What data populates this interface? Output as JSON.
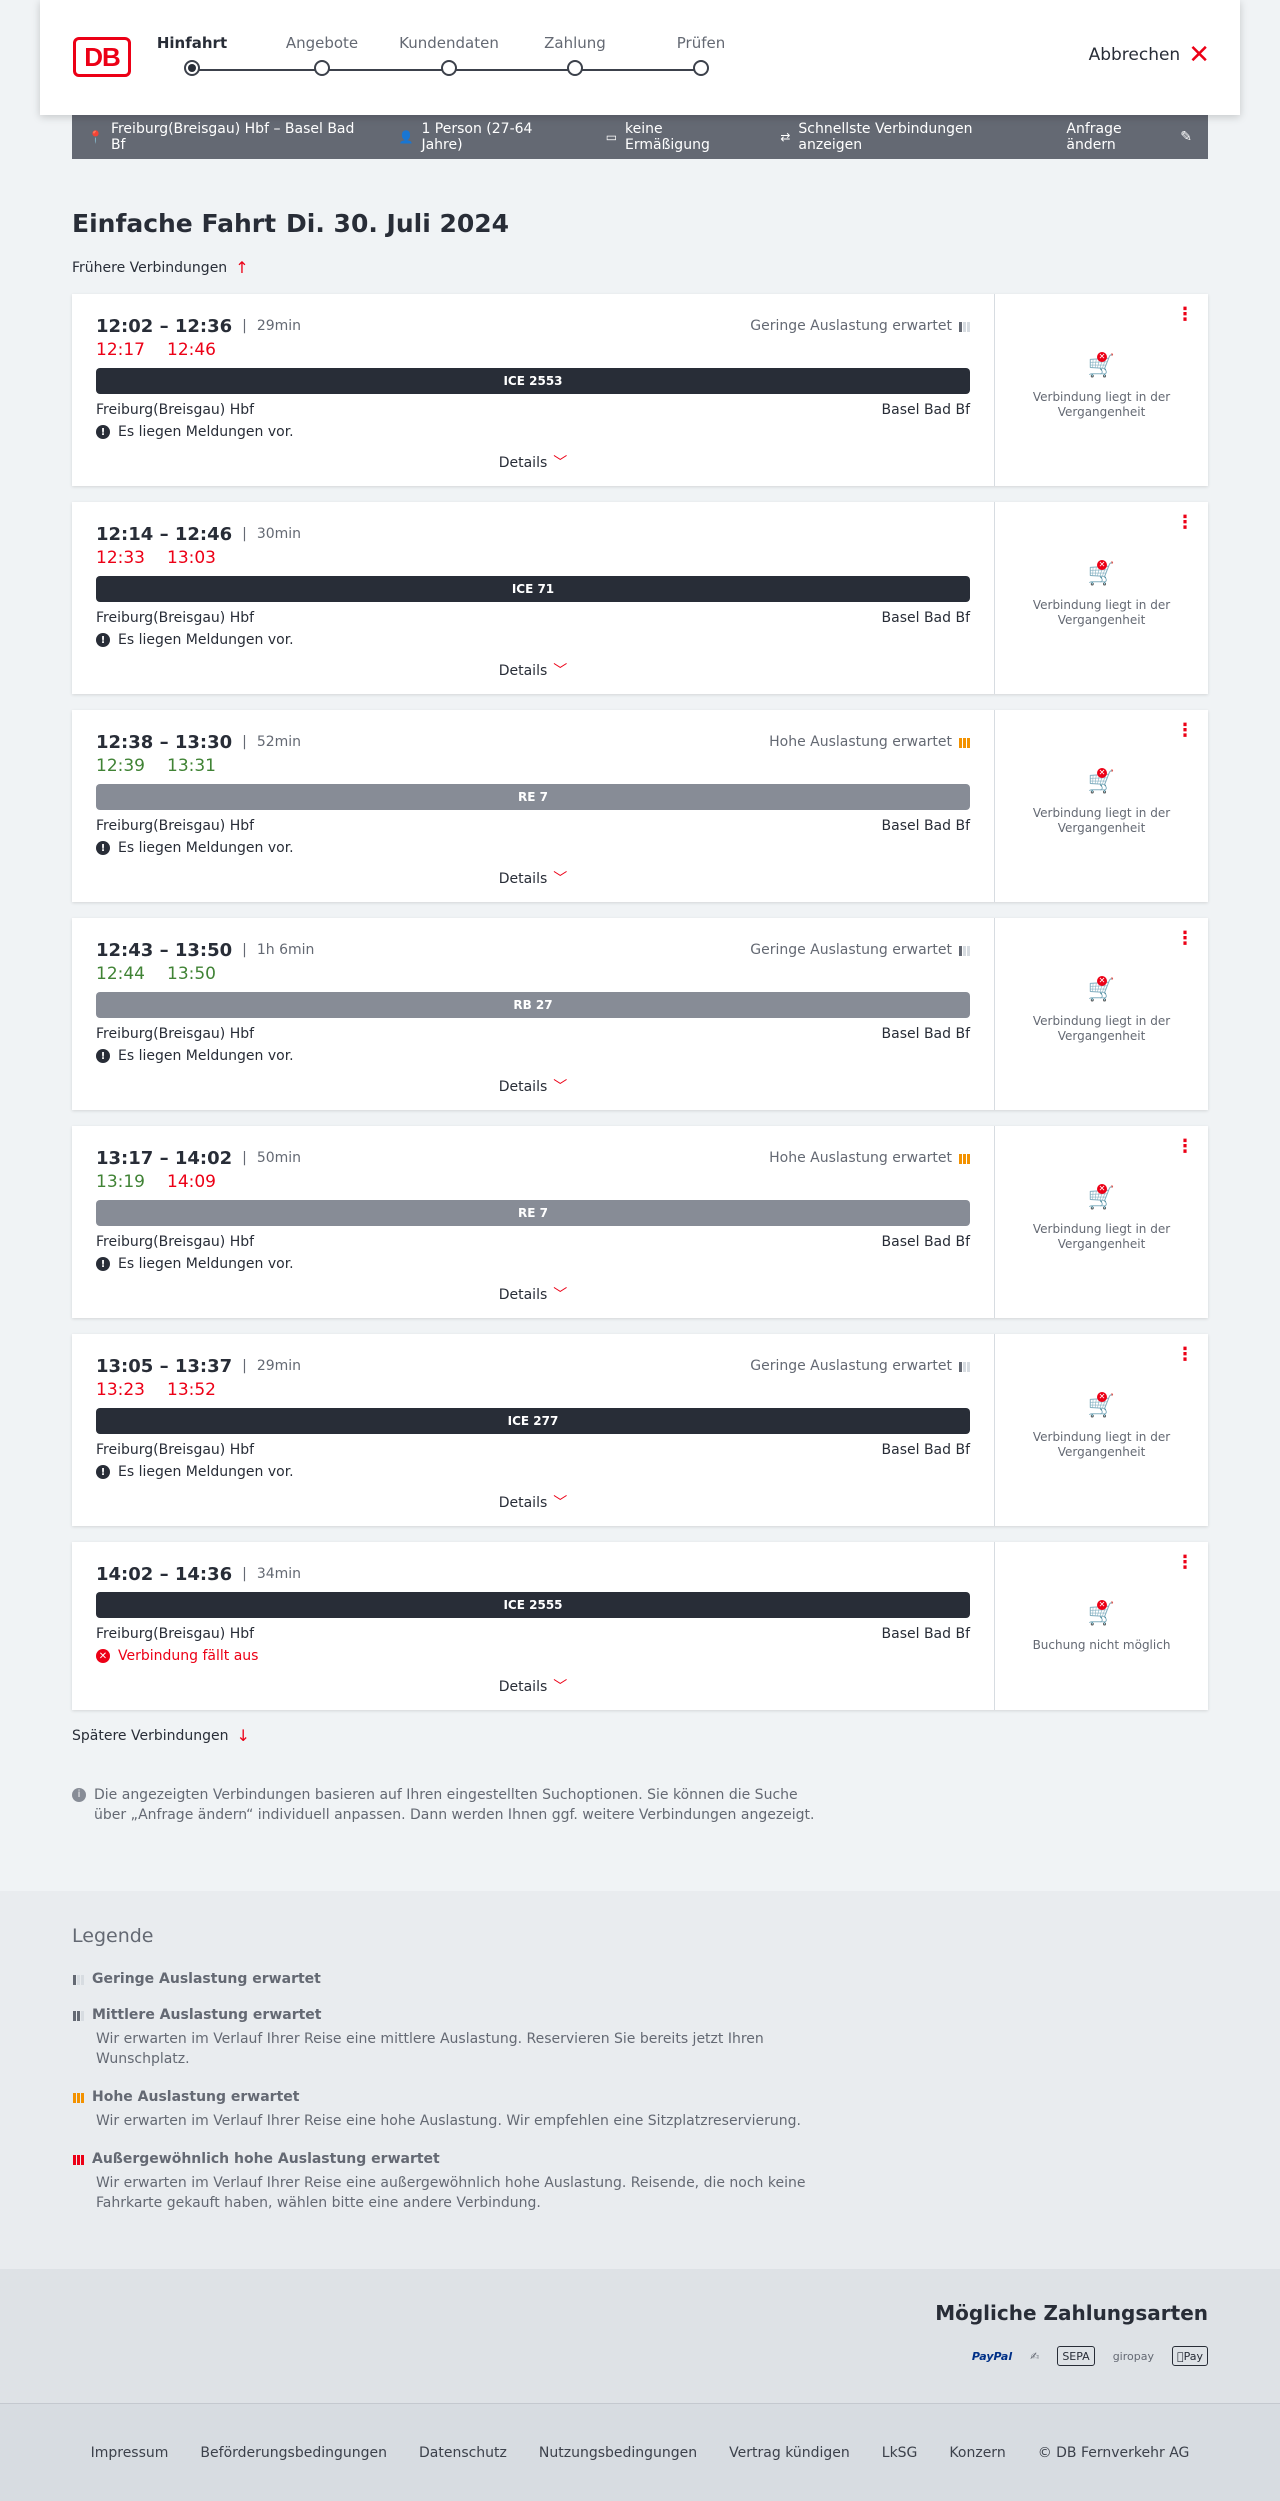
{
  "header": {
    "logo": "DB",
    "steps": [
      {
        "label": "Hinfahrt"
      },
      {
        "label": "Angebote"
      },
      {
        "label": "Kundendaten"
      },
      {
        "label": "Zahlung"
      },
      {
        "label": "Prüfen"
      }
    ],
    "active_step": 0,
    "abort_label": "Abbrechen"
  },
  "summary": {
    "route": "Freiburg(Breisgau) Hbf – Basel Bad Bf",
    "passengers": "1 Person (27-64 Jahre)",
    "discount": "keine Ermäßigung",
    "option": "Schnellste Verbindungen anzeigen",
    "change_label": "Anfrage ändern"
  },
  "title": {
    "bold": "Einfache Fahrt",
    "date": "Di. 30. Juli 2024"
  },
  "earlier_label": "Frühere Verbindungen",
  "later_label": "Spätere Verbindungen",
  "details_label": "Details",
  "connections": [
    {
      "times": "12:02 – 12:36",
      "duration": "29min",
      "occupancy": "Geringe Auslastung erwartet",
      "occ_level": "low",
      "rt_dep": "12:17",
      "rt_dep_status": "red",
      "rt_arr": "12:46",
      "rt_arr_status": "red",
      "train": "ICE 2553",
      "train_style": "dark",
      "from": "Freiburg(Breisgau) Hbf",
      "to": "Basel Bad Bf",
      "message": "Es liegen Meldungen vor.",
      "message_type": "info",
      "side_text": "Verbindung liegt in der Vergangenheit"
    },
    {
      "times": "12:14 – 12:46",
      "duration": "30min",
      "occupancy": "",
      "occ_level": "",
      "rt_dep": "12:33",
      "rt_dep_status": "red",
      "rt_arr": "13:03",
      "rt_arr_status": "red",
      "train": "ICE 71",
      "train_style": "dark",
      "from": "Freiburg(Breisgau) Hbf",
      "to": "Basel Bad Bf",
      "message": "Es liegen Meldungen vor.",
      "message_type": "info",
      "side_text": "Verbindung liegt in der Vergangenheit"
    },
    {
      "times": "12:38 – 13:30",
      "duration": "52min",
      "occupancy": "Hohe Auslastung erwartet",
      "occ_level": "high",
      "rt_dep": "12:39",
      "rt_dep_status": "green",
      "rt_arr": "13:31",
      "rt_arr_status": "green",
      "train": "RE 7",
      "train_style": "grey",
      "from": "Freiburg(Breisgau) Hbf",
      "to": "Basel Bad Bf",
      "message": "Es liegen Meldungen vor.",
      "message_type": "info",
      "side_text": "Verbindung liegt in der Vergangenheit"
    },
    {
      "times": "12:43 – 13:50",
      "duration": "1h 6min",
      "occupancy": "Geringe Auslastung erwartet",
      "occ_level": "low",
      "rt_dep": "12:44",
      "rt_dep_status": "green",
      "rt_arr": "13:50",
      "rt_arr_status": "green",
      "train": "RB 27",
      "train_style": "grey",
      "from": "Freiburg(Breisgau) Hbf",
      "to": "Basel Bad Bf",
      "message": "Es liegen Meldungen vor.",
      "message_type": "info",
      "side_text": "Verbindung liegt in der Vergangenheit"
    },
    {
      "times": "13:17 – 14:02",
      "duration": "50min",
      "occupancy": "Hohe Auslastung erwartet",
      "occ_level": "high",
      "rt_dep": "13:19",
      "rt_dep_status": "green",
      "rt_arr": "14:09",
      "rt_arr_status": "red",
      "train": "RE 7",
      "train_style": "grey",
      "from": "Freiburg(Breisgau) Hbf",
      "to": "Basel Bad Bf",
      "message": "Es liegen Meldungen vor.",
      "message_type": "info",
      "side_text": "Verbindung liegt in der Vergangenheit"
    },
    {
      "times": "13:05 – 13:37",
      "duration": "29min",
      "occupancy": "Geringe Auslastung erwartet",
      "occ_level": "low",
      "rt_dep": "13:23",
      "rt_dep_status": "red",
      "rt_arr": "13:52",
      "rt_arr_status": "red",
      "train": "ICE 277",
      "train_style": "dark",
      "from": "Freiburg(Breisgau) Hbf",
      "to": "Basel Bad Bf",
      "message": "Es liegen Meldungen vor.",
      "message_type": "info",
      "side_text": "Verbindung liegt in der Vergangenheit"
    },
    {
      "times": "14:02 – 14:36",
      "duration": "34min",
      "occupancy": "",
      "occ_level": "",
      "rt_dep": "",
      "rt_dep_status": "",
      "rt_arr": "",
      "rt_arr_status": "",
      "train": "ICE 2555",
      "train_style": "dark",
      "from": "Freiburg(Breisgau) Hbf",
      "to": "Basel Bad Bf",
      "message": "Verbindung fällt aus",
      "message_type": "cancel",
      "side_text": "Buchung nicht möglich"
    }
  ],
  "info_note": "Die angezeigten Verbindungen basieren auf Ihren eingestellten Suchoptionen. Sie können die Suche über „Anfrage ändern“ individuell anpassen. Dann werden Ihnen ggf. weitere Verbindungen angezeigt.",
  "legend": {
    "title": "Legende",
    "items": [
      {
        "level": "low",
        "title": "Geringe Auslastung erwartet",
        "desc": ""
      },
      {
        "level": "mid",
        "title": "Mittlere Auslastung erwartet",
        "desc": "Wir erwarten im Verlauf Ihrer Reise eine mittlere Auslastung. Reservieren Sie bereits jetzt Ihren Wunschplatz."
      },
      {
        "level": "high",
        "title": "Hohe Auslastung erwartet",
        "desc": "Wir erwarten im Verlauf Ihrer Reise eine hohe Auslastung. Wir empfehlen eine Sitzplatzreservierung."
      },
      {
        "level": "extreme",
        "title": "Außergewöhnlich hohe Auslastung erwartet",
        "desc": "Wir erwarten im Verlauf Ihrer Reise eine außergewöhnlich hohe Auslastung. Reisende, die noch keine Fahrkarte gekauft haben, wählen bitte eine andere Verbindung."
      }
    ]
  },
  "payment": {
    "title": "Mögliche Zahlungsarten",
    "methods": [
      "PayPal",
      "Lastschrift",
      "SEPA",
      "giropay",
      "Pay"
    ]
  },
  "footer": {
    "links": [
      "Impressum",
      "Beförderungsbedingungen",
      "Datenschutz",
      "Nutzungsbedingungen",
      "Vertrag kündigen",
      "LkSG",
      "Konzern",
      "© DB Fernverkehr AG"
    ]
  },
  "colors": {
    "brand_red": "#ec0016",
    "delay_red": "#ec0016",
    "on_time_green": "#408335",
    "high_occupancy": "#f39200",
    "train_dark": "#282d37",
    "train_grey": "#878c96"
  }
}
